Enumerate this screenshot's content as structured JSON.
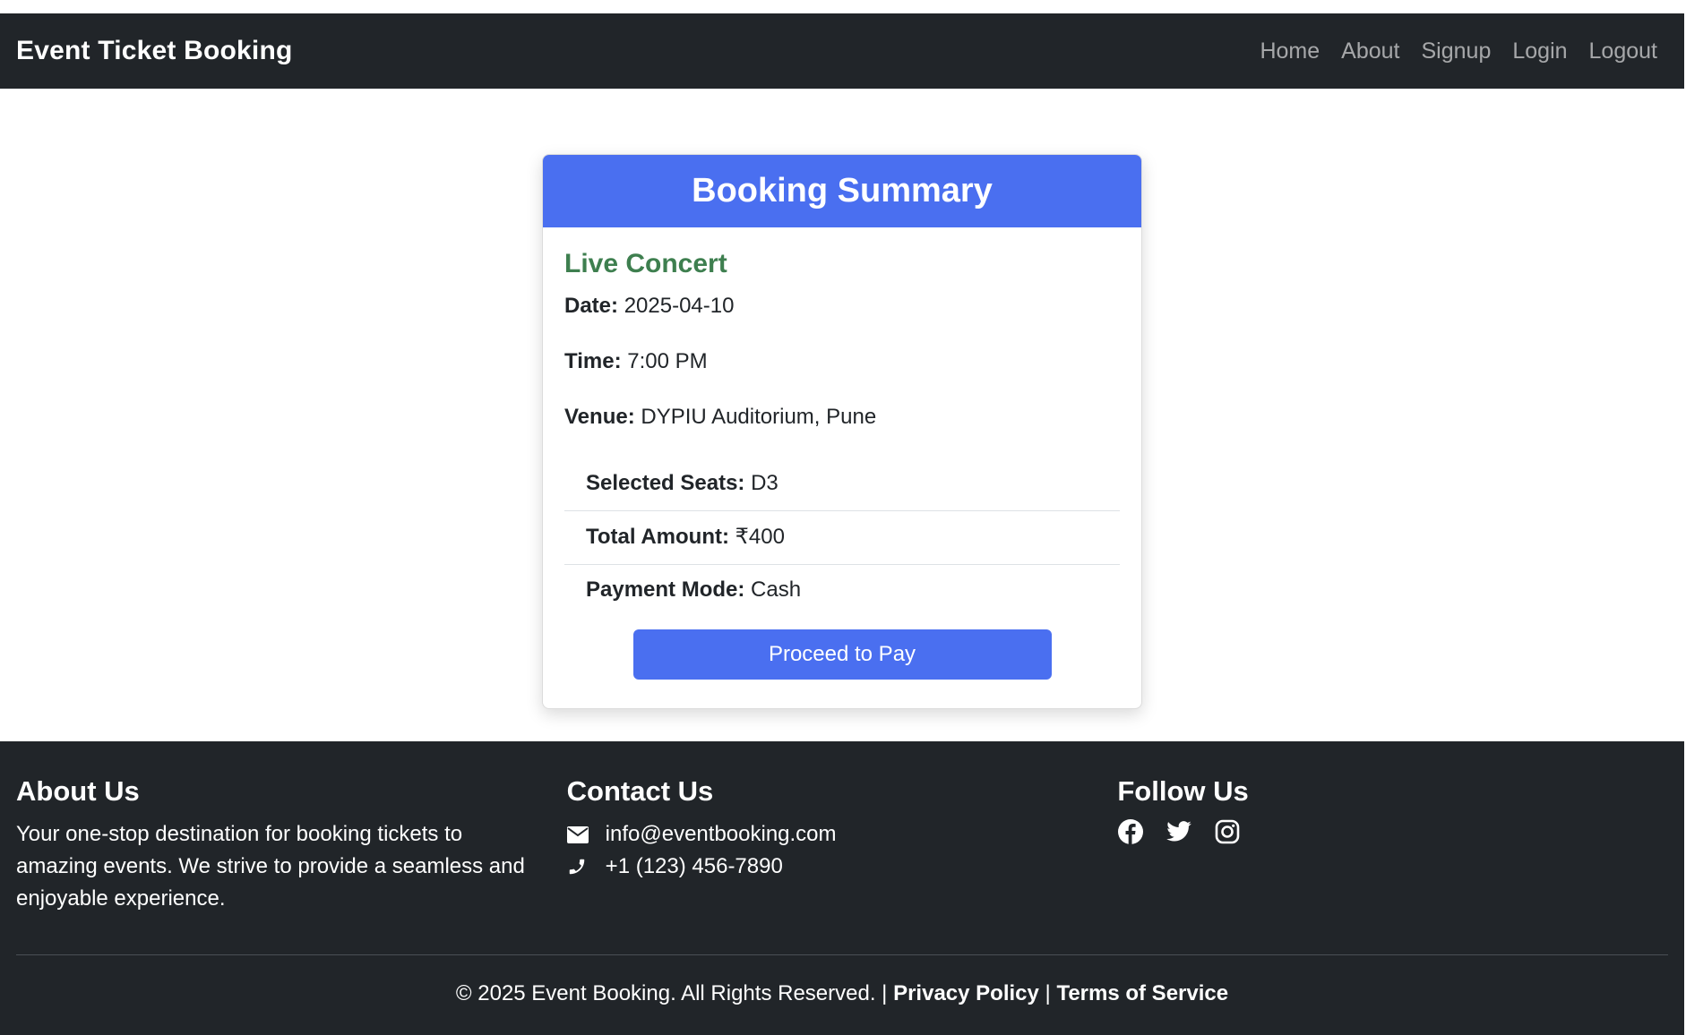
{
  "navbar": {
    "brand": "Event Ticket Booking",
    "links": [
      "Home",
      "About",
      "Signup",
      "Login",
      "Logout"
    ]
  },
  "booking": {
    "header": "Booking Summary",
    "event_title": "Live Concert",
    "date_label": "Date:",
    "date_value": "2025-04-10",
    "time_label": "Time:",
    "time_value": "7:00 PM",
    "venue_label": "Venue:",
    "venue_value": "DYPIU Auditorium, Pune",
    "seats_label": "Selected Seats:",
    "seats_value": "D3",
    "amount_label": "Total Amount:",
    "amount_value": "₹400",
    "payment_label": "Payment Mode:",
    "payment_value": "Cash",
    "proceed_label": "Proceed to Pay"
  },
  "footer": {
    "about_title": "About Us",
    "about_text": "Your one-stop destination for booking tickets to amazing events. We strive to provide a seamless and enjoyable experience.",
    "contact_title": "Contact Us",
    "email": "info@eventbooking.com",
    "phone": "+1 (123) 456-7890",
    "follow_title": "Follow Us",
    "social_icons": [
      "facebook-icon",
      "twitter-icon",
      "instagram-icon"
    ],
    "copyright": "© 2025 Event Booking. All Rights Reserved. |",
    "privacy": "Privacy Policy",
    "separator": "|",
    "terms": "Terms of Service"
  },
  "colors": {
    "navbar_bg": "#212529",
    "primary": "#4a6ff0",
    "event_title": "#3e7f4f"
  }
}
